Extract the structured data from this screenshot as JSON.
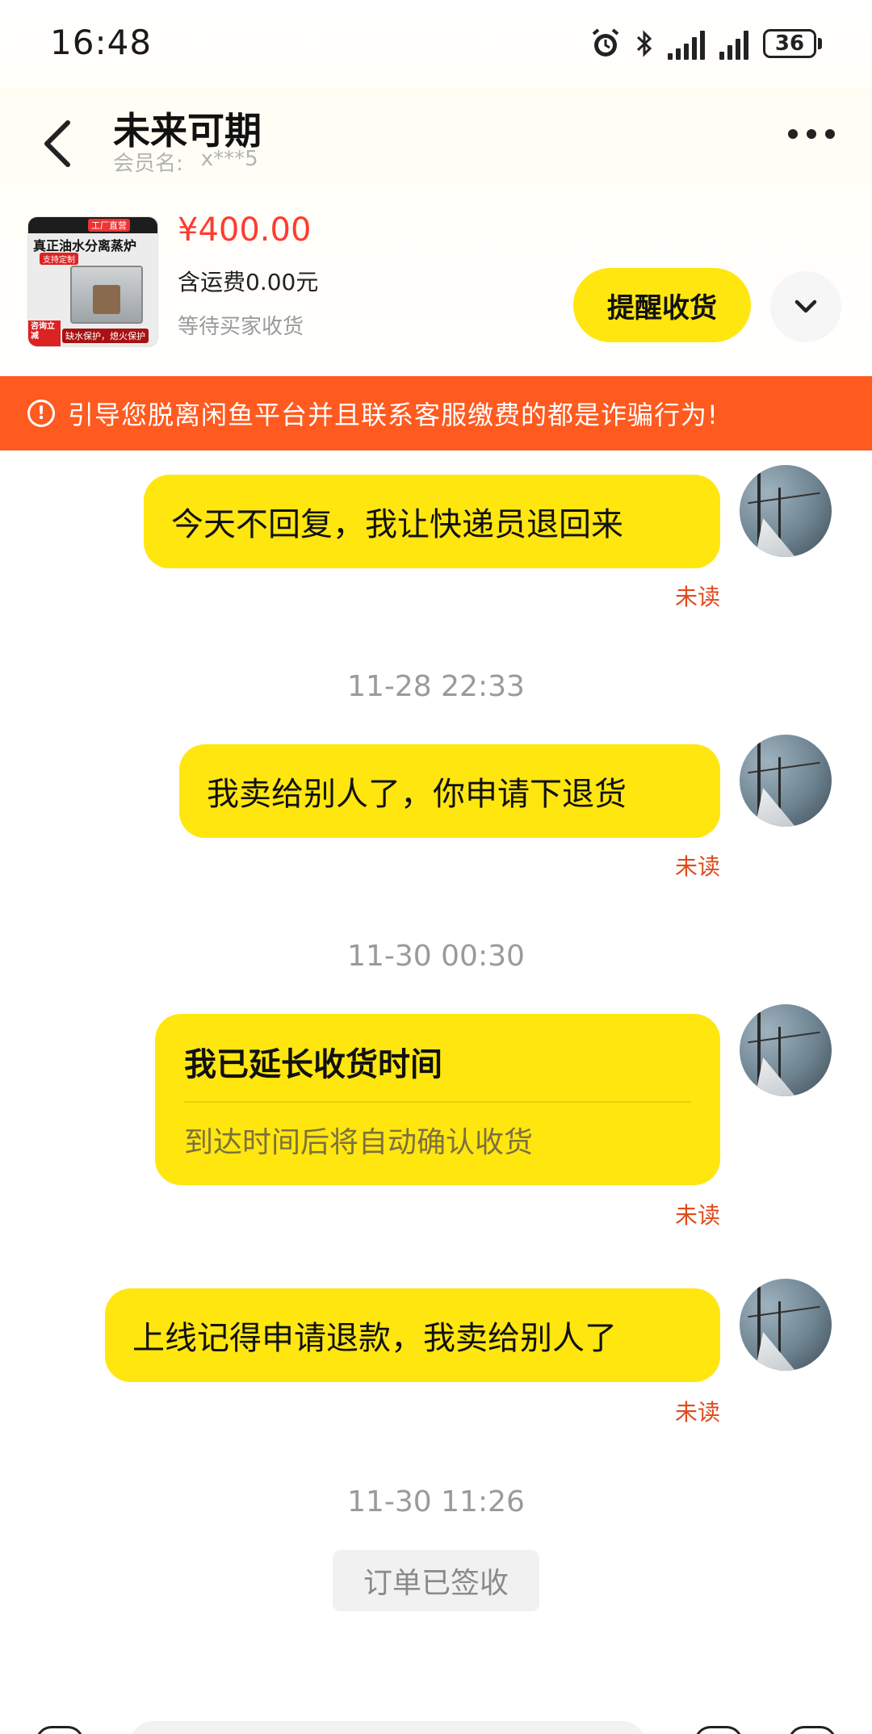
{
  "status_bar": {
    "time": "16:48",
    "battery": "36",
    "icons": [
      "alarm-icon",
      "bluetooth-icon",
      "signal-icon",
      "signal-icon",
      "battery-icon"
    ]
  },
  "header": {
    "title": "未来可期",
    "member_label": "会员名:",
    "member_value": "x***5"
  },
  "product": {
    "image_title": "真正油水分离蒸炉",
    "image_brand": "工厂直营",
    "image_tag": "支持定制",
    "image_footer": "缺水保护，熄火保护",
    "image_side": "咨询立减",
    "price": "¥400.00",
    "shipping": "含运费0.00元",
    "status": "等待买家收货",
    "remind_button": "提醒收货"
  },
  "warning": {
    "text": "引导您脱离闲鱼平台并且联系客服缴费的都是诈骗行为!"
  },
  "messages": {
    "m1": "今天不回复，我让快递员退回来",
    "m1_status": "未读",
    "ts1": "11-28 22:33",
    "m2": "我卖给别人了，你申请下退货",
    "m2_status": "未读",
    "ts2": "11-30 00:30",
    "card_title": "我已延长收货时间",
    "card_sub": "到达时间后将自动确认收货",
    "card_status": "未读",
    "m3": "上线记得申请退款，我卖给别人了",
    "m3_status": "未读",
    "ts3": "11-30 11:26",
    "system_badge": "订单已签收"
  },
  "colors": {
    "accent_yellow": "#ffe60f",
    "warning_orange": "#ff5a1f",
    "price_red": "#ff3b30",
    "unread_red": "#e04a1c"
  }
}
